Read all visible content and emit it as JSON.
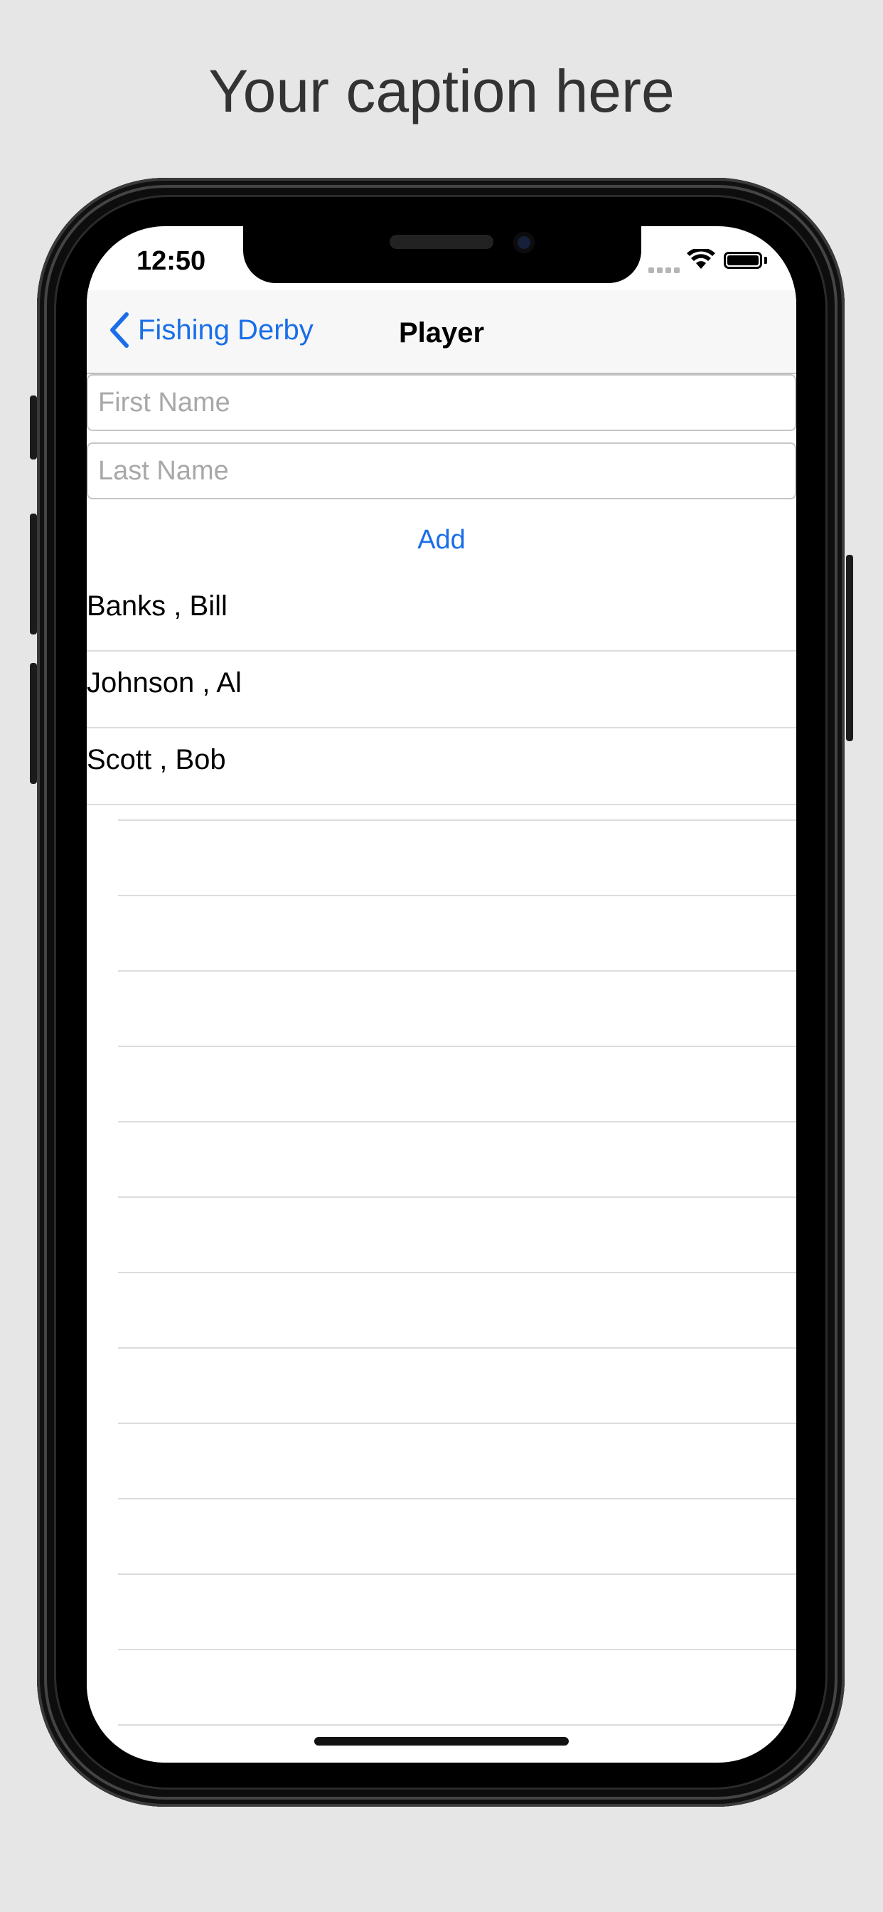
{
  "caption": "Your caption here",
  "status_bar": {
    "time": "12:50",
    "wifi_icon": "wifi-icon",
    "battery_icon": "battery-icon",
    "signal_icon": "cellular-signal-icon"
  },
  "nav": {
    "back_label": "Fishing Derby",
    "back_icon": "chevron-left-icon",
    "title": "Player"
  },
  "form": {
    "first_name_placeholder": "First Name",
    "first_name_value": "",
    "last_name_placeholder": "Last Name",
    "last_name_value": "",
    "add_label": "Add"
  },
  "players": [
    {
      "name": "Banks ,  Bill"
    },
    {
      "name": "Johnson ,  Al"
    },
    {
      "name": "Scott ,  Bob"
    }
  ],
  "colors": {
    "accent": "#1a6ee8",
    "background": "#e6e6e6",
    "nav_background": "#f7f7f7",
    "separator": "#dcdcdc",
    "placeholder": "#a8a8a8"
  }
}
